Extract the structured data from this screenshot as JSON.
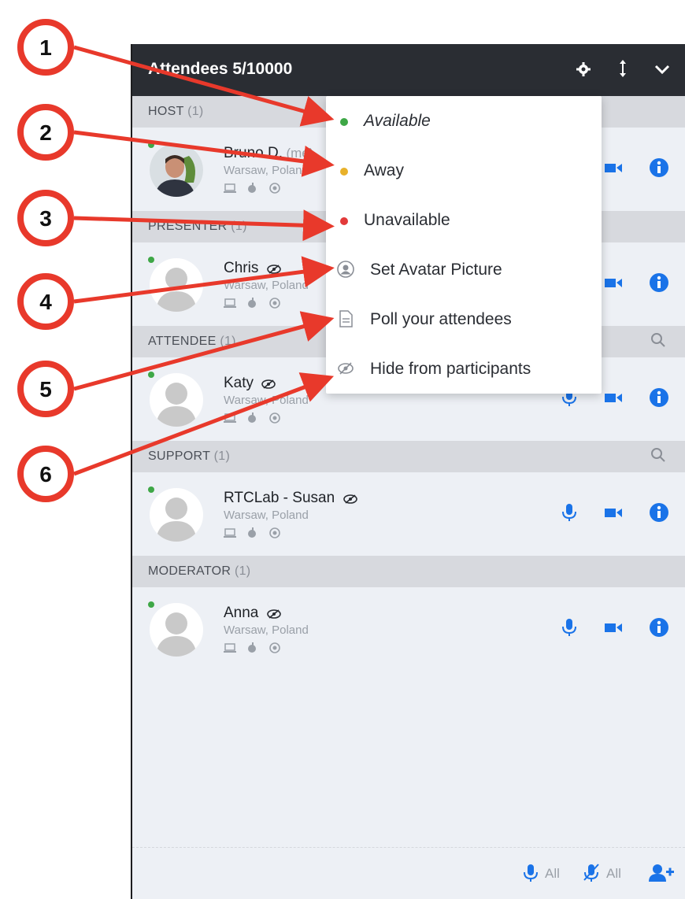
{
  "header": {
    "title": "Attendees 5/10000",
    "icons": [
      "gear-icon",
      "sort-icon",
      "chevron-down-icon"
    ]
  },
  "sections": [
    {
      "label": "HOST",
      "count": "(1)",
      "search": false
    },
    {
      "label": "PRESENTER",
      "count": "(1)",
      "search": false
    },
    {
      "label": "ATTENDEE",
      "count": "(1)",
      "search": true
    },
    {
      "label": "SUPPORT",
      "count": "(1)",
      "search": true
    },
    {
      "label": "MODERATOR",
      "count": "(1)",
      "search": false
    }
  ],
  "attendees": [
    {
      "name": "Bruno D.",
      "suffix": "(me)",
      "location": "Warsaw, Poland",
      "avatar": "photo",
      "hidden": false,
      "mic": false
    },
    {
      "name": "Chris",
      "location": "Warsaw, Poland",
      "avatar": "placeholder",
      "hidden": true,
      "mic": false
    },
    {
      "name": "Katy",
      "location": "Warsaw, Poland",
      "avatar": "placeholder",
      "hidden": true,
      "mic": true
    },
    {
      "name": "RTCLab - Susan",
      "location": "Warsaw, Poland",
      "avatar": "placeholder",
      "hidden": true,
      "mic": true
    },
    {
      "name": "Anna",
      "location": "Warsaw, Poland",
      "avatar": "placeholder",
      "hidden": true,
      "mic": true
    }
  ],
  "menu": {
    "items": [
      {
        "label": "Available",
        "type": "status",
        "color": "#3ea746",
        "italic": true
      },
      {
        "label": "Away",
        "type": "status",
        "color": "#e8b12a",
        "italic": false
      },
      {
        "label": "Unavailable",
        "type": "status",
        "color": "#e23a3a",
        "italic": false
      },
      {
        "label": "Set Avatar Picture",
        "type": "icon",
        "icon": "avatar-icon"
      },
      {
        "label": "Poll your attendees",
        "type": "icon",
        "icon": "document-icon"
      },
      {
        "label": "Hide from participants",
        "type": "icon",
        "icon": "eye-slash-icon"
      }
    ]
  },
  "footer": {
    "mute_all_label": "All",
    "unmute_all_label": "All",
    "icons": [
      "microphone-icon",
      "microphone-slash-icon",
      "add-user-icon"
    ]
  },
  "callouts": [
    "1",
    "2",
    "3",
    "4",
    "5",
    "6"
  ],
  "colors": {
    "accent": "#1a73e8",
    "header_bg": "#2a2d33",
    "callout": "#e8392b",
    "online": "#3ea746"
  }
}
